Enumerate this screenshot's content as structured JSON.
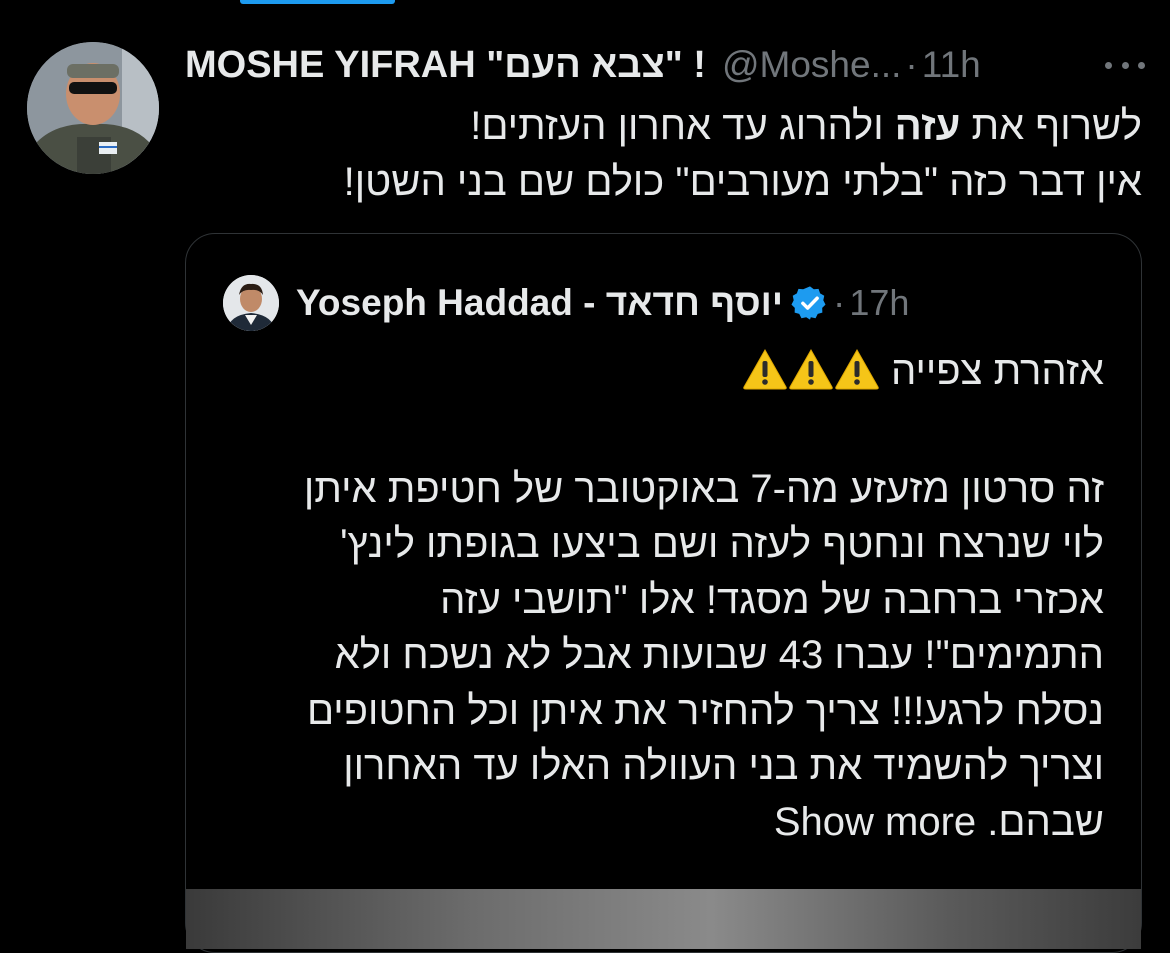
{
  "colors": {
    "background": "#000000",
    "text": "#e7e9ea",
    "secondary": "#71767b",
    "accent": "#1d9bf0",
    "border": "#2f3336"
  },
  "post": {
    "display_name": "MOSHE YIFRAH \"צבא העם\" !",
    "handle": "@Moshe...",
    "separator": "·",
    "time": "11h",
    "more_icon": "more-horizontal-icon",
    "text_line1_a": "לשרוף את ",
    "text_line1_bold": "עזה",
    "text_line1_b": " ולהרוג עד אחרון העזתים!",
    "text_line2": "אין דבר כזה \"בלתי מעורבים\" כולם שם בני השטן!"
  },
  "quote": {
    "display_name": "Yoseph Haddad - יוסף חדאד",
    "verified_icon": "verified-badge-icon",
    "separator": "·",
    "time": "17h",
    "warning_heading": "אזהרת צפייה",
    "warning_icon": "warning-icon",
    "lines": [
      "זה סרטון מזעזע מה-7 באוקטובר של חטיפת איתן",
      "לוי שנרצח ונחטף לעזה ושם ביצעו בגופתו לינץ'",
      "אכזרי ברחבה של מסגד! אלו \"תושבי עזה",
      "התמימים\"! עברו 43 שבועות אבל לא נשכח ולא",
      "נסלח לרגע!!! צריך להחזיר את איתן וכל החטופים",
      "וצריך להשמיד את בני העוולה האלו עד האחרון"
    ],
    "last_line": "שבהם.",
    "show_more": "Show more"
  }
}
